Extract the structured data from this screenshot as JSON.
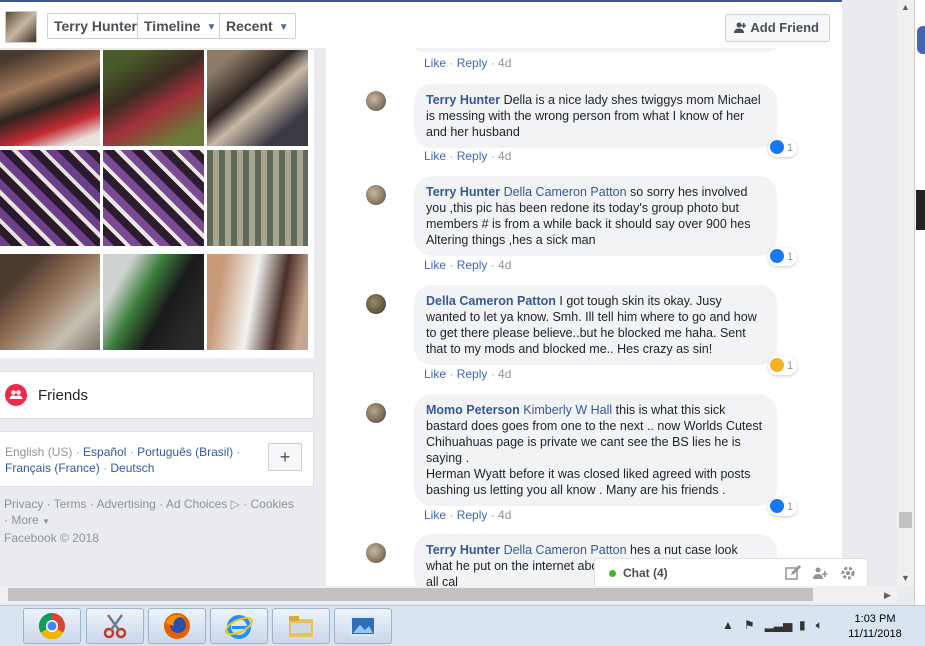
{
  "header": {
    "profile_name": "Terry Hunter",
    "timeline_label": "Timeline",
    "recent_label": "Recent",
    "add_friend_label": "Add Friend"
  },
  "sidebar": {
    "friends_label": "Friends",
    "languages": {
      "current": "English (US)",
      "options": [
        "Español",
        "Português (Brasil)",
        "Français (France)",
        "Deutsch"
      ]
    },
    "add_language": "+",
    "footer_links": [
      "Privacy",
      "Terms",
      "Advertising",
      "Ad Choices",
      "Cookies",
      "More"
    ],
    "copyright": "Facebook © 2018"
  },
  "comments": [
    {
      "author": "",
      "tag": "",
      "text": "",
      "like": "Like",
      "reply": "Reply",
      "time": "4d",
      "reaction": null
    },
    {
      "author": "Terry Hunter",
      "tag": "",
      "text": "Della is a nice lady shes twiggys mom Michael is messing with the wrong person from what I know of her and her husband",
      "like": "Like",
      "reply": "Reply",
      "time": "4d",
      "reaction": {
        "type": "like",
        "count": "1"
      }
    },
    {
      "author": "Terry Hunter",
      "tag": "Della Cameron Patton",
      "text": "so sorry hes involved you ,this pic has been redone its today's group photo but members # is from a while back it should say over 900 hes Altering things ,hes a sick man",
      "like": "Like",
      "reply": "Reply",
      "time": "4d",
      "reaction": {
        "type": "like",
        "count": "1"
      }
    },
    {
      "author": "Della Cameron Patton",
      "tag": "",
      "text": "I got tough skin its okay. Jusy wanted to let ya know. Smh. Ill tell him where to go and how to get there please believe..but he blocked me haha. Sent that to my mods and blocked me.. Hes crazy as sin!",
      "like": "Like",
      "reply": "Reply",
      "time": "4d",
      "reaction": {
        "type": "wow",
        "count": "1"
      }
    },
    {
      "author": "Momo Peterson",
      "tag": "Kimberly W Hall",
      "text": "this is what this sick bastard does goes from one to the next .. now Worlds Cutest Chihuahuas page is private we cant see the BS lies he is saying .",
      "text2": "Herman Wyatt before it was closed liked agreed with posts bashing us letting you all know . Many are his friends .",
      "like": "Like",
      "reply": "Reply",
      "time": "4d",
      "reaction": {
        "type": "like",
        "count": "1"
      }
    },
    {
      "author": "Terry Hunter",
      "tag": "Della Cameron Patton",
      "text": "hes a nut case look what he put on the internet about a child molester we have all cal",
      "like": "",
      "reply": "",
      "time": "",
      "reaction": null
    }
  ],
  "chat": {
    "label": "Chat (4)"
  },
  "taskbar": {
    "time": "1:03 PM",
    "date": "11/11/2018"
  }
}
